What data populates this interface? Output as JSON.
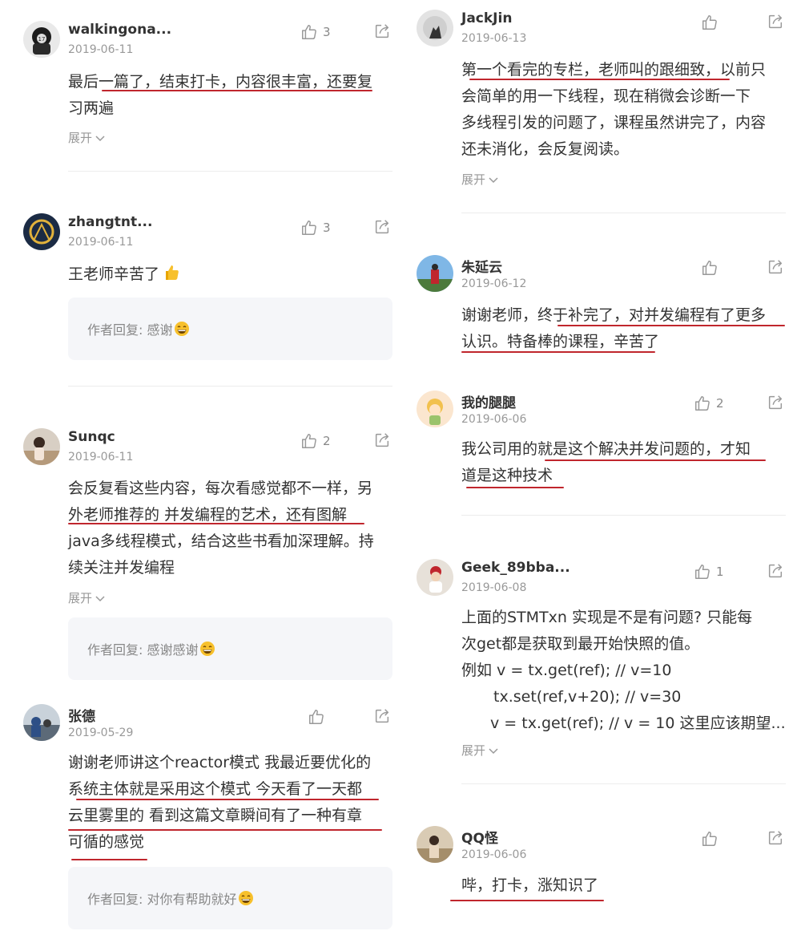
{
  "left_column": [
    {
      "username": "walkingona...",
      "date": "2019-06-11",
      "likes": "3",
      "lines": [
        "最后一篇了，结束打卡，内容很丰富，还要复",
        "习两遍"
      ],
      "expand": "展开"
    },
    {
      "username": "zhangtnt...",
      "date": "2019-06-11",
      "likes": "3",
      "lines": [
        "王老师辛苦了"
      ],
      "reply": "作者回复: 感谢"
    },
    {
      "username": "Sunqc",
      "date": "2019-06-11",
      "likes": "2",
      "lines": [
        "会反复看这些内容，每次看感觉都不一样，另",
        "外老师推荐的 并发编程的艺术，还有图解",
        "java多线程模式，结合这些书看加深理解。持",
        "续关注并发编程"
      ],
      "expand": "展开",
      "reply": "作者回复: 感谢感谢"
    },
    {
      "username": "张德",
      "date": "2019-05-29",
      "likes": "",
      "lines": [
        "谢谢老师讲这个reactor模式 我最近要优化的",
        "系统主体就是采用这个模式 今天看了一天都",
        "云里雾里的 看到这篇文章瞬间有了一种有章",
        "可循的感觉"
      ],
      "reply": "作者回复: 对你有帮助就好"
    }
  ],
  "right_column": [
    {
      "username": "JackJin",
      "date": "2019-06-13",
      "likes": "",
      "lines": [
        "第一个看完的专栏，老师叫的跟细致，以前只",
        "会简单的用一下线程，现在稍微会诊断一下",
        "多线程引发的问题了，课程虽然讲完了，内容",
        "还未消化，会反复阅读。"
      ],
      "expand": "展开"
    },
    {
      "username": "朱延云",
      "date": "2019-06-12",
      "likes": "",
      "lines": [
        "谢谢老师，终于补完了，对并发编程有了更多",
        "认识。特备棒的课程，辛苦了"
      ]
    },
    {
      "username": "我的腿腿",
      "date": "2019-06-06",
      "likes": "2",
      "lines": [
        "我公司用的就是这个解决并发问题的，才知",
        "道是这种技术"
      ]
    },
    {
      "username": "Geek_89bba...",
      "date": "2019-06-08",
      "likes": "1",
      "lines": [
        "上面的STMTxn 实现是不是有问题? 只能每",
        "次get都是获取到最开始快照的值。",
        "例如 v = tx.get(ref); // v=10",
        "tx.set(ref,v+20); // v=30",
        "v = tx.get(ref); // v = 10 这里应该期望..."
      ],
      "expand": "展开"
    },
    {
      "username": "QQ怪",
      "date": "2019-06-06",
      "likes": "",
      "lines": [
        "哔，打卡，涨知识了"
      ]
    }
  ],
  "colors": {
    "underline": "#c0262d",
    "text": "#333333",
    "meta": "#999999",
    "reply_bg": "#f5f6f9"
  },
  "icons": {
    "like": "thumbs-up-icon",
    "share": "share-icon",
    "expand": "chevron-down-icon"
  }
}
